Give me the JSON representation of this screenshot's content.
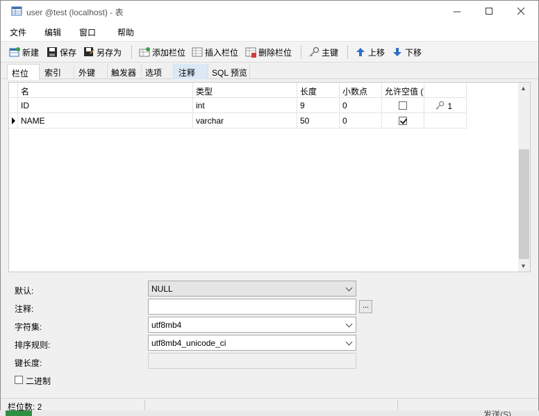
{
  "window": {
    "title": "user @test (localhost) - 表"
  },
  "menu": [
    "文件",
    "编辑",
    "窗口",
    "帮助"
  ],
  "toolbar": {
    "new": "新建",
    "save": "保存",
    "save_as": "另存为",
    "add_field": "添加栏位",
    "insert_field": "插入栏位",
    "delete_field": "删除栏位",
    "primary_key": "主键",
    "move_up": "上移",
    "move_down": "下移"
  },
  "tabs": [
    "栏位",
    "索引",
    "外键",
    "触发器",
    "选项",
    "注释",
    "SQL 预览"
  ],
  "grid": {
    "headers": [
      "名",
      "类型",
      "长度",
      "小数点",
      "允许空值 ("
    ],
    "rows": [
      {
        "name": "ID",
        "type": "int",
        "length": "9",
        "decimals": "0",
        "nullable": false,
        "key": "1"
      },
      {
        "name": "NAME",
        "type": "varchar",
        "length": "50",
        "decimals": "0",
        "nullable": true,
        "key": ""
      }
    ]
  },
  "props": {
    "default_label": "默认:",
    "default_value": "NULL",
    "comment_label": "注释:",
    "comment_value": "",
    "comment_button": "...",
    "charset_label": "字符集:",
    "charset_value": "utf8mb4",
    "collation_label": "排序规则:",
    "collation_value": "utf8mb4_unicode_ci",
    "keylen_label": "键长度:",
    "keylen_value": "",
    "binary_label": "二进制",
    "binary_checked": false
  },
  "status": {
    "field_count": "栏位数: 2"
  },
  "background": {
    "fragment": "发送(S)"
  }
}
